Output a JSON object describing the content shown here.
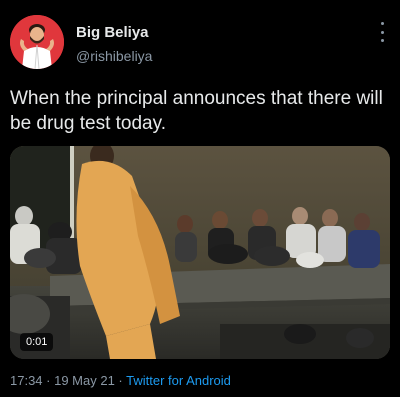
{
  "author": {
    "name": "Big Beliya",
    "handle": "@rishibeliya",
    "avatar_bg": "#e0373c",
    "more_icon": "more-vertical-icon"
  },
  "tweet": {
    "text": "When the principal announces that there will be drug test today."
  },
  "media": {
    "duration": "0:01"
  },
  "meta": {
    "time": "17:34",
    "separator1": " · ",
    "date": "19 May 21",
    "separator2": " · ",
    "source": "Twitter for Android"
  },
  "colors": {
    "background": "#000000",
    "link": "#1d9bf0",
    "secondary_text": "#8b98a5"
  }
}
